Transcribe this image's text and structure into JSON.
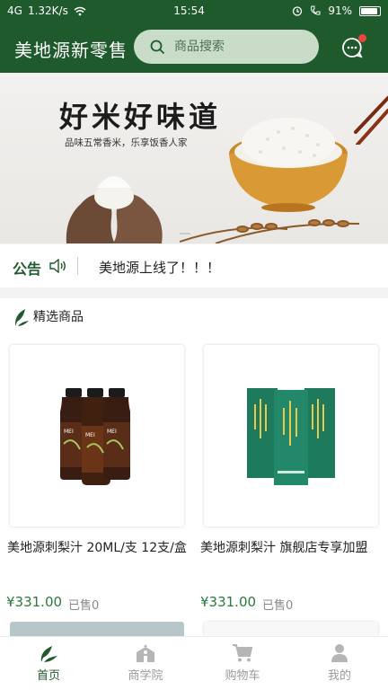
{
  "status_bar": {
    "signal": "4G",
    "speed": "1.32K/s",
    "time": "15:54",
    "battery": "91%"
  },
  "header": {
    "brand": "美地源新零售",
    "search_placeholder": "商品搜索"
  },
  "banner": {
    "title": "好米好味道",
    "subtitle": "品味五常香米，乐享饭香人家"
  },
  "notice": {
    "tag": "公告",
    "text": "美地源上线了！！！"
  },
  "section": {
    "title": "精选商品"
  },
  "products": [
    {
      "name": "美地源刺梨汁 20ML/支 12支/盒",
      "price": "¥331.00",
      "sold": "已售0"
    },
    {
      "name": "美地源刺梨汁 旗舰店专享加盟",
      "price": "¥331.00",
      "sold": "已售0"
    }
  ],
  "tabbar": [
    {
      "label": "首页",
      "icon": "home-leaf-icon",
      "active": true
    },
    {
      "label": "商学院",
      "icon": "school-icon",
      "active": false
    },
    {
      "label": "购物车",
      "icon": "cart-icon",
      "active": false
    },
    {
      "label": "我的",
      "icon": "user-icon",
      "active": false
    }
  ],
  "colors": {
    "brand_green": "#1f5a2d",
    "price_green": "#2a7a3d",
    "badge_red": "#e8463b"
  }
}
